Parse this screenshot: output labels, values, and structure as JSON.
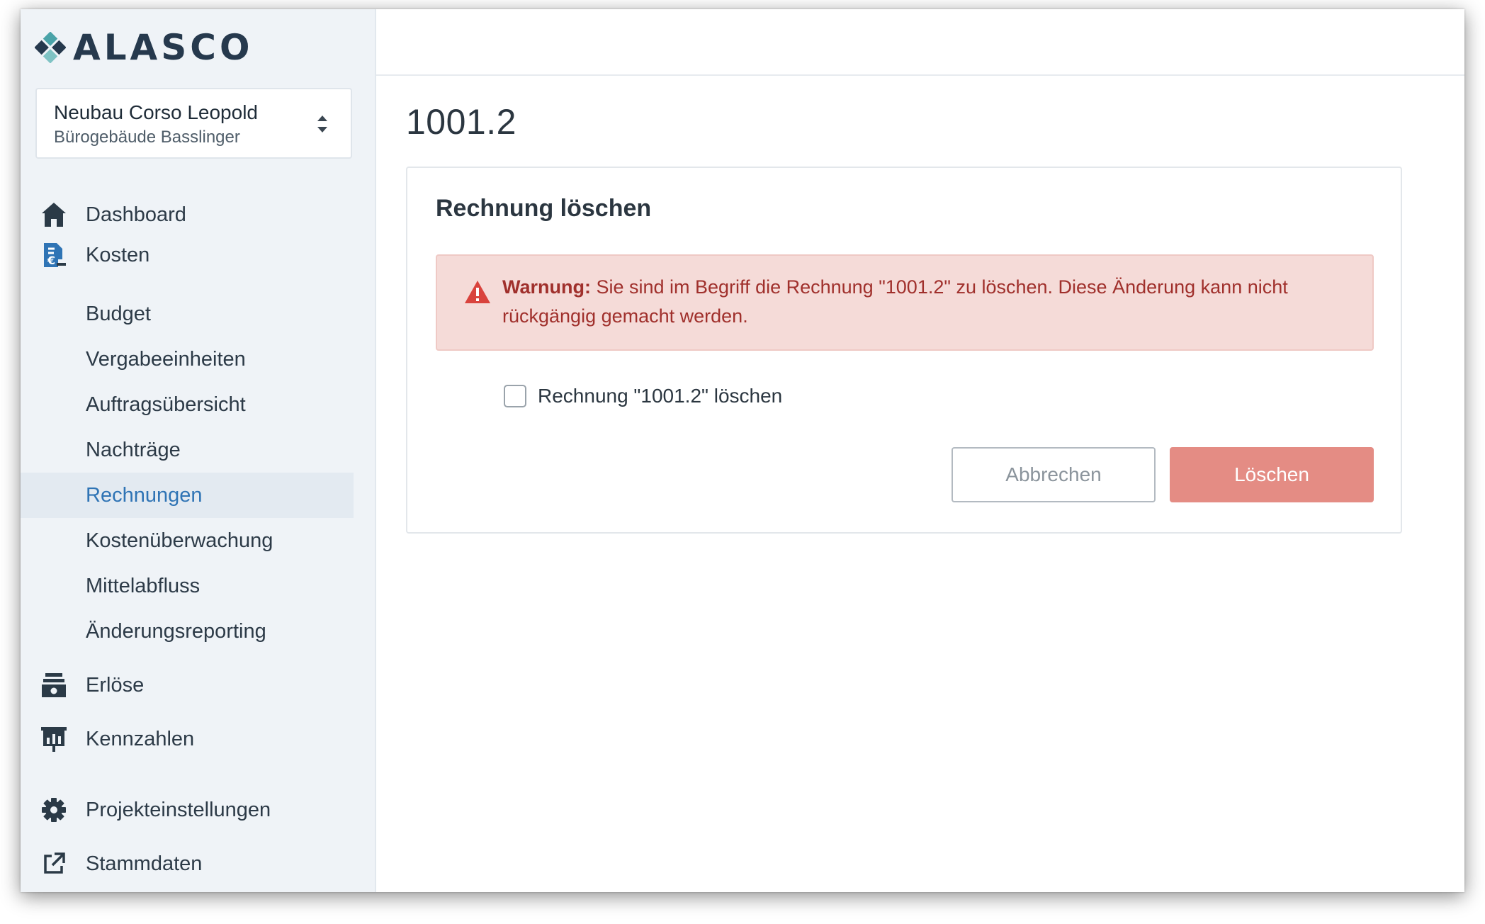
{
  "brand": {
    "name": "ALASCO"
  },
  "project": {
    "name": "Neubau Corso Leopold",
    "subtitle": "Bürogebäude Basslinger"
  },
  "sidebar": {
    "items": [
      {
        "label": "Dashboard",
        "icon": "home-icon",
        "level": 1
      },
      {
        "label": "Kosten",
        "icon": "cost-document-icon",
        "level": 1
      },
      {
        "label": "Budget",
        "level": 2
      },
      {
        "label": "Vergabeeinheiten",
        "level": 2
      },
      {
        "label": "Auftragsübersicht",
        "level": 2
      },
      {
        "label": "Nachträge",
        "level": 2
      },
      {
        "label": "Rechnungen",
        "level": 2,
        "active": true
      },
      {
        "label": "Kostenüberwachung",
        "level": 2
      },
      {
        "label": "Mittelabfluss",
        "level": 2
      },
      {
        "label": "Änderungsreporting",
        "level": 2
      },
      {
        "label": "Erlöse",
        "icon": "cash-register-icon",
        "level": 1
      },
      {
        "label": "Kennzahlen",
        "icon": "presentation-chart-icon",
        "level": 1
      },
      {
        "label": "Projekteinstellungen",
        "icon": "gear-icon",
        "level": 1
      },
      {
        "label": "Stammdaten",
        "icon": "external-link-icon",
        "level": 1
      }
    ]
  },
  "main": {
    "title": "1001.2",
    "card": {
      "title": "Rechnung löschen",
      "alert": {
        "prefix": "Warnung:",
        "message": " Sie sind im Begriff die Rechnung \"1001.2\" zu löschen. Diese Änderung kann nicht rückgängig gemacht werden."
      },
      "checkbox_label": "Rechnung \"1001.2\" löschen",
      "checked": false,
      "cancel_label": "Abbrechen",
      "delete_label": "Löschen"
    }
  },
  "colors": {
    "accent": "#2f74b5",
    "danger_text": "#a0302c",
    "danger_bg": "#f5dbd8",
    "delete_button": "#e48c84",
    "logo_teal": "#4aa3a8"
  }
}
